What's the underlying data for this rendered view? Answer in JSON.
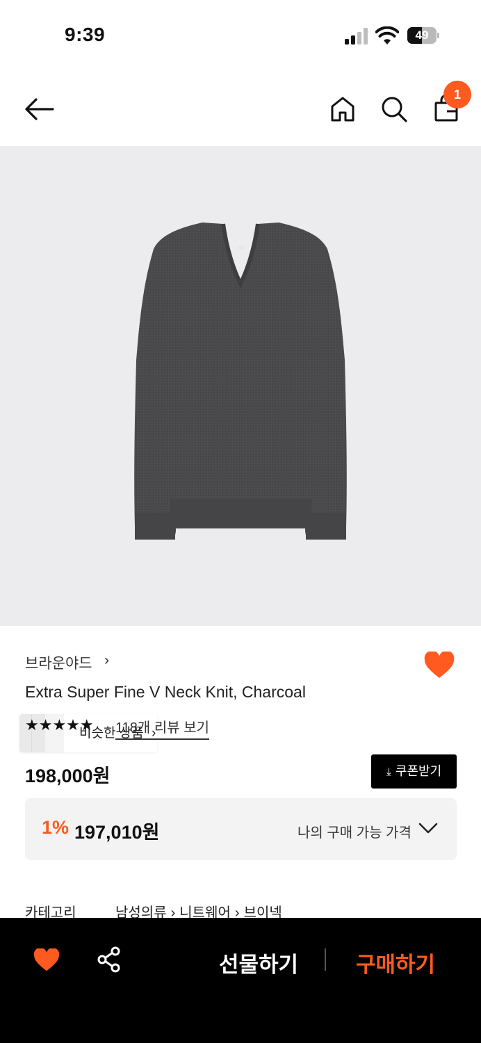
{
  "status_bar": {
    "time": "9:39",
    "battery": "49",
    "battery_level": 0.49
  },
  "header": {
    "back_icon": "back-arrow-icon",
    "home_icon": "home-icon",
    "search_icon": "search-icon",
    "cart_icon": "shopping-bag-icon",
    "cart_count": "1"
  },
  "hero": {
    "similar_label": "비슷한 상품",
    "similar_chevron": "›"
  },
  "product": {
    "brand": "브라운야드",
    "brand_chevron": "›",
    "name": "Extra Super Fine V Neck Knit, Charcoal",
    "rating_stars": "★★★★★",
    "reviews_link": "118개 리뷰 보기",
    "price": "198,000원",
    "coupon_label": "쿠폰받기",
    "my_price": {
      "discount": "1%",
      "price": "197,010원",
      "label": "나의 구매 가능 가격"
    },
    "category_label": "카테고리",
    "category_path": [
      "남성의류",
      "니트웨어",
      "브이넥"
    ],
    "category_sep": "›"
  },
  "bottom_bar": {
    "gift_label": "선물하기",
    "buy_label": "구매하기"
  },
  "colors": {
    "accent": "#ff5a1f",
    "hero_bg": "#ececee",
    "sweater": "#4a4a4c"
  }
}
